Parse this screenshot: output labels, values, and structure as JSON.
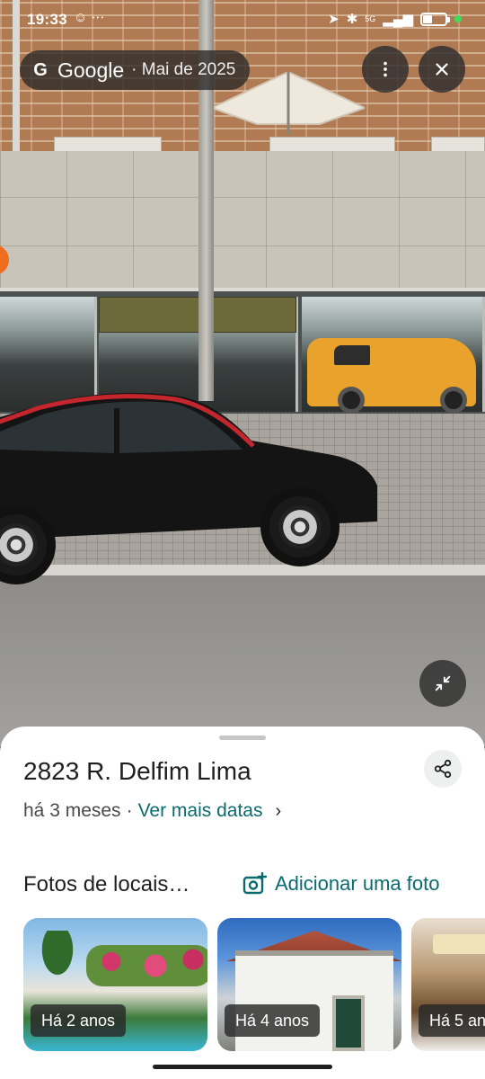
{
  "status_bar": {
    "time": "19:33",
    "network": "5G",
    "left_icons": [
      "kid-icon",
      "dots-icon"
    ],
    "right_icons": [
      "location-icon",
      "bluetooth-icon",
      "signal-icon",
      "battery-icon"
    ]
  },
  "street_view": {
    "source_logo": "G",
    "source_name": "Google",
    "capture_date": "· Mai de 2025",
    "menu_icon": "more-vert-icon",
    "close_icon": "close-icon",
    "collapse_icon": "collapse-icon"
  },
  "place": {
    "title": "2823 R. Delfim Lima",
    "relative_date": "há 3 meses",
    "separator": "·",
    "more_dates_label": "Ver mais datas",
    "share_icon": "share-icon"
  },
  "photos_section": {
    "title": "Fotos de locais…",
    "add_photo_label": "Adicionar uma foto",
    "photos": [
      {
        "age": "Há 2 anos"
      },
      {
        "age": "Há 4 anos"
      },
      {
        "age": "Há 5 an"
      }
    ]
  },
  "colors": {
    "accent_teal": "#0b6a70",
    "sheet_bg": "#ffffff",
    "pill_bg": "#282828"
  }
}
